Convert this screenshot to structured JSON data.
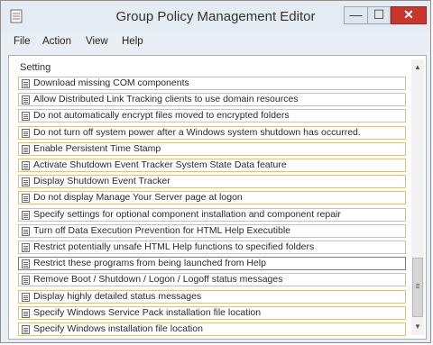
{
  "window": {
    "title": "Group Policy Management Editor"
  },
  "controls": {
    "minimize": "—",
    "maximize": "☐",
    "close": "✕"
  },
  "menu": [
    "File",
    "Action",
    "View",
    "Help"
  ],
  "list": {
    "column_header": "Setting",
    "items": [
      "Download missing COM components",
      "Allow Distributed Link Tracking clients to use domain resources",
      "Do not automatically encrypt files moved to encrypted folders",
      "Do not turn off system power after a Windows system shutdown has occurred.",
      "Enable Persistent Time Stamp",
      "Activate Shutdown Event Tracker System State Data feature",
      "Display Shutdown Event Tracker",
      "Do not display Manage Your Server page at logon",
      "Specify settings for optional component installation and component repair",
      "Turn off Data Execution Prevention for HTML Help Executible",
      "Restrict potentially unsafe HTML Help functions to specified folders",
      "Restrict these programs from being launched from Help",
      "Remove Boot / Shutdown / Logon / Logoff status messages",
      "Display highly detailed status messages",
      "Specify Windows Service Pack installation file location",
      "Specify Windows installation file location"
    ],
    "selected_item": "Restrict these programs from being launched from Help"
  },
  "scrollbar": {
    "up_arrow": "▲",
    "down_arrow": "▼"
  }
}
